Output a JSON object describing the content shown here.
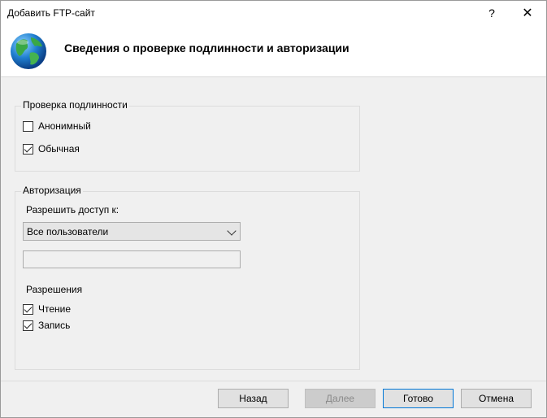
{
  "window": {
    "title": "Добавить FTP-сайт",
    "help": "?",
    "close": "✕"
  },
  "header": {
    "title": "Сведения о проверке подлинности и авторизации"
  },
  "auth": {
    "label": "Проверка подлинности",
    "anonymous": {
      "label": "Анонимный",
      "checked": false
    },
    "basic": {
      "label": "Обычная",
      "checked": true
    }
  },
  "authorization": {
    "label": "Авторизация",
    "allow_label": "Разрешить доступ к:",
    "allow_value": "Все пользователи",
    "users_value": "",
    "permissions_label": "Разрешения",
    "read": {
      "label": "Чтение",
      "checked": true
    },
    "write": {
      "label": "Запись",
      "checked": true
    }
  },
  "buttons": {
    "back": "Назад",
    "next": "Далее",
    "finish": "Готово",
    "cancel": "Отмена"
  }
}
